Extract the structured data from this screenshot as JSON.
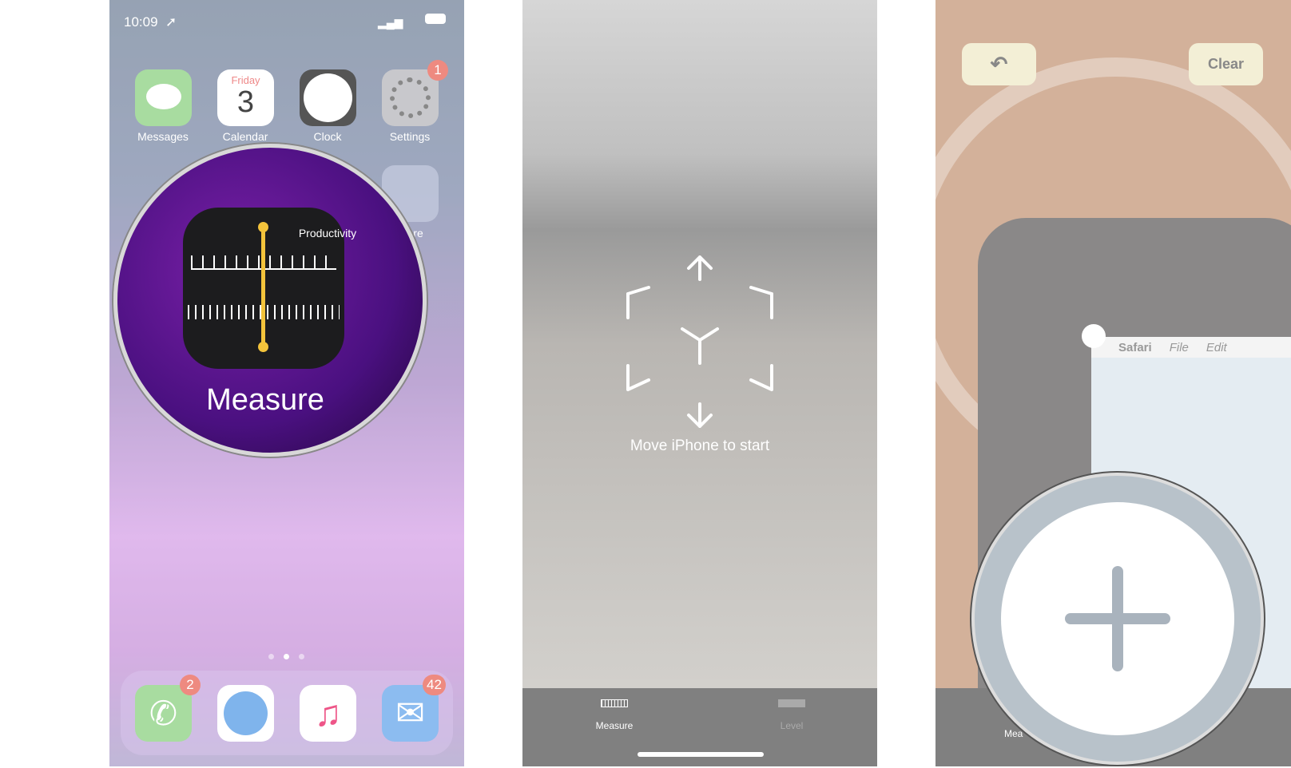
{
  "panel1": {
    "status": {
      "time": "10:09"
    },
    "apps_row1": [
      {
        "label": "Messages",
        "color": "#a8dca0"
      },
      {
        "label": "Calendar",
        "day": "Friday",
        "date": "3",
        "color": "#ffffff"
      },
      {
        "label": "Clock",
        "color": "#555555"
      },
      {
        "label": "Settings",
        "color": "#c8c8cc",
        "badge": "1"
      }
    ],
    "apps_row2": [
      {
        "label": "Productivity"
      },
      {
        "label": "Store"
      }
    ],
    "magnified_label": "Measure",
    "dock": [
      {
        "name": "Phone",
        "badge": "2",
        "color": "#a8dca0"
      },
      {
        "name": "Safari",
        "color": "#ffffff"
      },
      {
        "name": "Music",
        "color": "#ffffff"
      },
      {
        "name": "Mail",
        "badge": "42",
        "color": "#8cbcf0"
      }
    ],
    "page_dots": 3,
    "active_page": 2
  },
  "panel2": {
    "hint": "Move iPhone to start",
    "tabs": [
      {
        "label": "Measure",
        "active": true
      },
      {
        "label": "Level",
        "active": false
      }
    ]
  },
  "panel3": {
    "clear_label": "Clear",
    "screen_menu": [
      "Safari",
      "File",
      "Edit"
    ],
    "tab_partial": "Mea"
  }
}
